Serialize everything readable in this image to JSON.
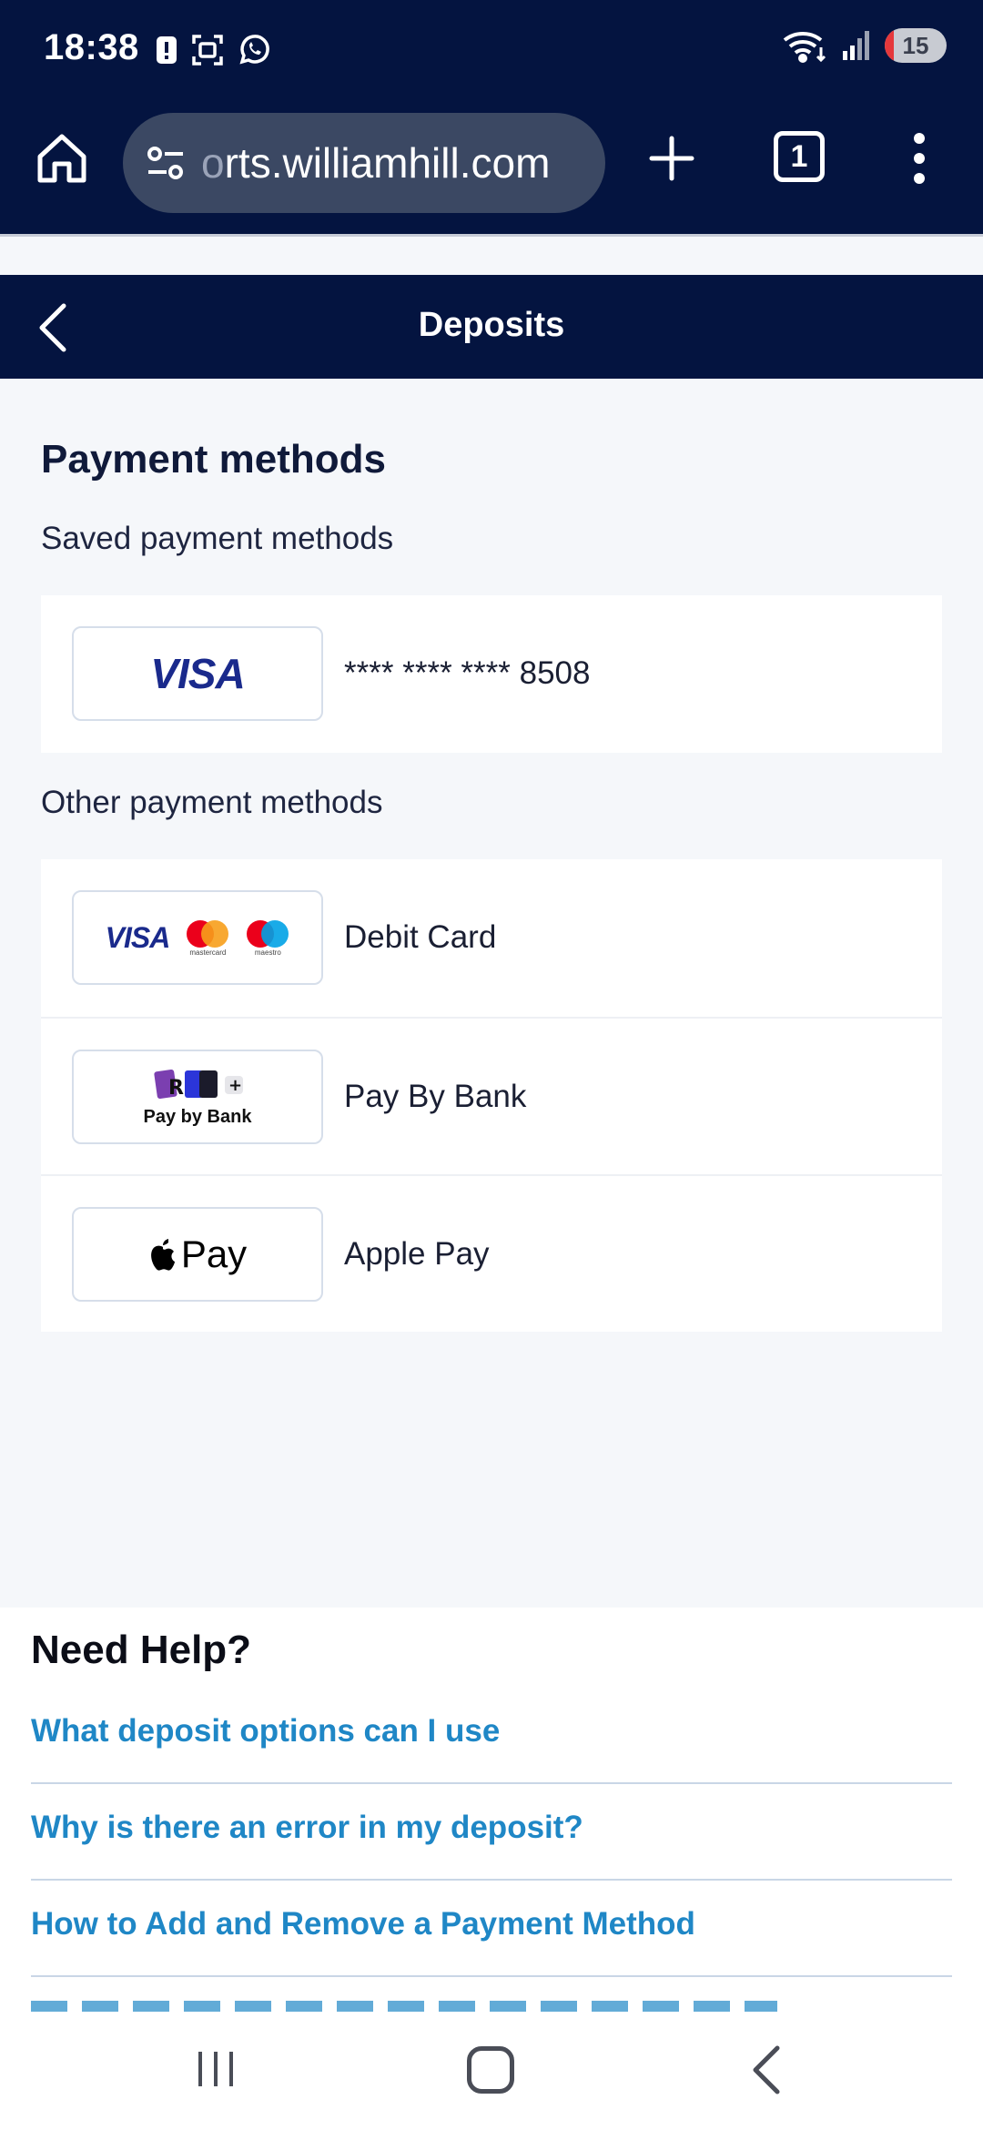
{
  "status_bar": {
    "time": "18:38",
    "battery_level": "15",
    "icons": [
      "alert-icon",
      "screenshot-icon",
      "whatsapp-icon",
      "wifi-icon",
      "signal-icon",
      "battery-icon"
    ]
  },
  "browser": {
    "url": "orts.williamhill.com",
    "url_prefix_faded": "o",
    "url_rest": "rts.williamhill.com",
    "tab_count": "1"
  },
  "header": {
    "title": "Deposits"
  },
  "payment": {
    "title": "Payment methods",
    "saved_title": "Saved payment methods",
    "saved": [
      {
        "logo": "VISA",
        "label": "**** **** **** 8508"
      }
    ],
    "other_title": "Other payment methods",
    "other": [
      {
        "logo": "visa-mastercard-maestro",
        "label": "Debit Card",
        "logo_visa": "VISA",
        "logo_mc": "mastercard",
        "logo_maestro": "maestro"
      },
      {
        "logo": "pay-by-bank",
        "label": "Pay By Bank",
        "logo_text": "Pay by Bank"
      },
      {
        "logo": "apple-pay",
        "label": "Apple Pay",
        "logo_text": "Pay"
      }
    ]
  },
  "help": {
    "title": "Need Help?",
    "links": [
      "What deposit options can I use",
      "Why is there an error in my deposit?",
      "How to Add and Remove a Payment Method"
    ]
  },
  "colors": {
    "navy": "#041440",
    "link_blue": "#1f87c6",
    "visa_blue": "#1a2a8c"
  }
}
